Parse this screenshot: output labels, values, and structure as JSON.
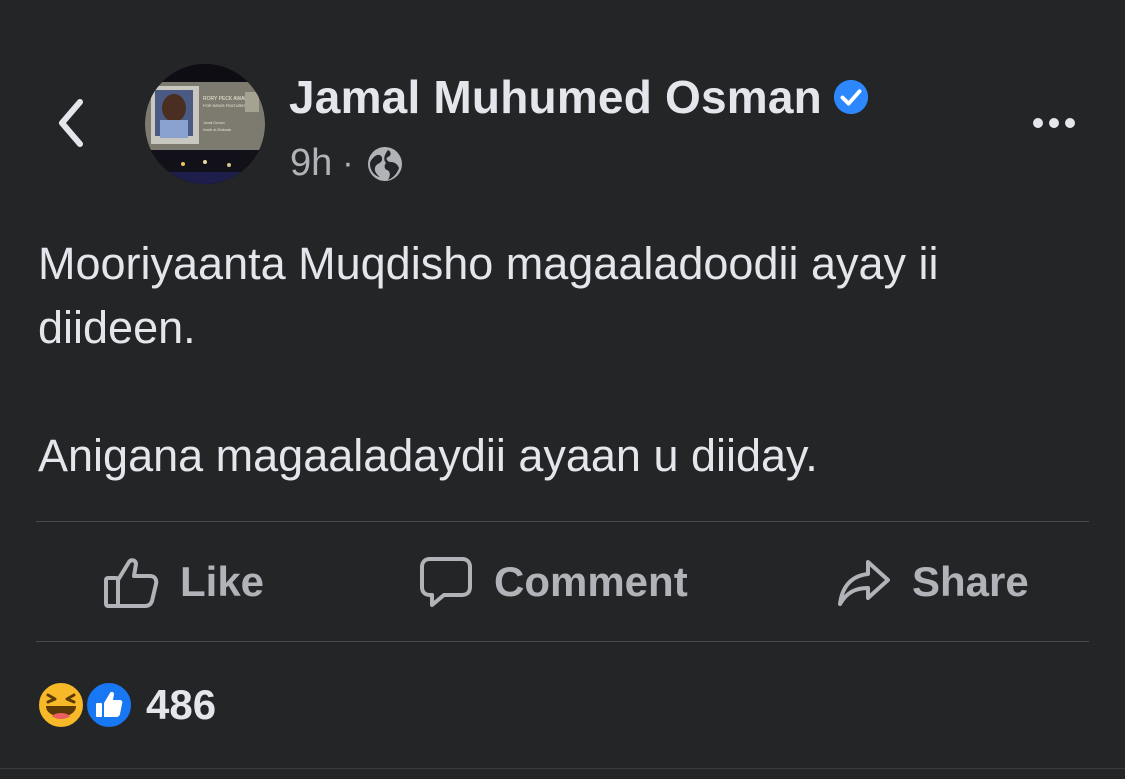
{
  "post": {
    "author": "Jamal Muhumed Osman",
    "verified": true,
    "time": "9h",
    "separator": "·",
    "audience_icon": "globe-icon",
    "avatar_caption": {
      "award": "RORY PECK AWARD",
      "category": "FOR NEWS FEATURES",
      "name": "Jamal Osman",
      "subtitle": "Inside al-Shabaab"
    },
    "text_lines": [
      "Mooriyaanta Muqdisho magaaladoodii ayay ii diideen.",
      "Anigana magaaladaydii ayaan u diiday."
    ]
  },
  "actions": {
    "like_label": "Like",
    "comment_label": "Comment",
    "share_label": "Share"
  },
  "reactions": {
    "types": [
      "haha-icon",
      "like-icon"
    ],
    "count": "486"
  },
  "colors": {
    "background": "#242526",
    "text": "#e4e6eb",
    "secondary": "#b0b3b8",
    "verified": "#2d88ff",
    "haha": "#f7b928",
    "like": "#1877f2"
  }
}
